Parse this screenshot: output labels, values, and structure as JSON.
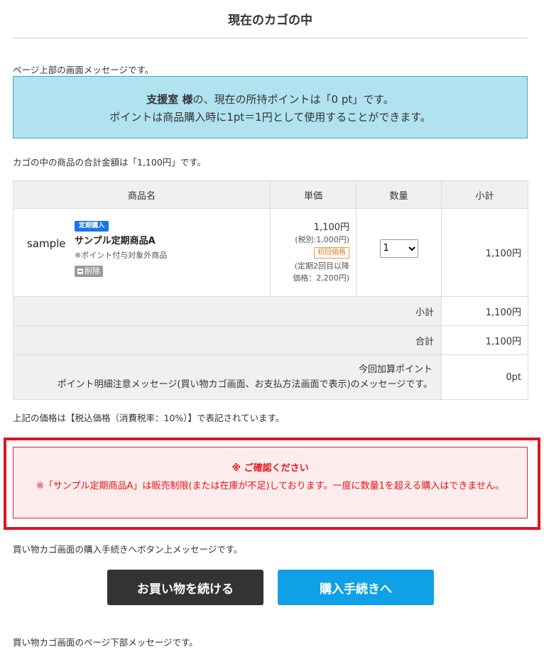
{
  "header": {
    "title": "現在のカゴの中"
  },
  "messages": {
    "top": "ページ上部の画面メッセージです。",
    "cart_total": "カゴの中の商品の合計金額は「1,100円」です。",
    "tax_note": "上記の価格は【税込価格（消費税率：10%）】で表記されています。",
    "button_top": "買い物カゴ画面の購入手続きへボタン上メッセージです。",
    "bottom": "買い物カゴ画面のページ下部メッセージです。"
  },
  "points_box": {
    "user_name": "支援室 様",
    "line1_rest": "の、現在の所持ポイントは「0 pt」です。",
    "line2": "ポイントは商品購入時に1pt＝1円として使用することができます。",
    "color": "#b1e2f0"
  },
  "table": {
    "headers": [
      "商品名",
      "単価",
      "数量",
      "小計"
    ],
    "item": {
      "image_text": "sample",
      "badge": "定期購入",
      "name": "サンプル定期商品A",
      "note": "※ポイント付与対象外商品",
      "delete_label": "削除",
      "price": "1,100円",
      "price_tax": "(税別:1,000円)",
      "first_badge": "初回価格",
      "price_next_1": "(定期2回目以降",
      "price_next_2": "価格：2,200円)",
      "quantity": "1",
      "subtotal": "1,100円"
    },
    "subtotal_label": "小計",
    "subtotal_value": "1,100円",
    "total_label": "合計",
    "total_value": "1,100円",
    "points_label_1": "今回加算ポイント",
    "points_label_2": "ポイント明細注意メッセージ(買い物カゴ画面、お支払方法画面で表示)のメッセージです。",
    "points_value": "0pt"
  },
  "alert": {
    "title": "※ ご確認ください",
    "body": "※「サンプル定期商品A」は販売制限(または在庫が不足)しております。一度に数量1を超える購入はできません。",
    "color": "#e5141d"
  },
  "buttons": {
    "continue_label": "お買い物を続ける",
    "checkout_label": "購入手続きへ",
    "continue_color": "#333333",
    "checkout_color": "#0fa0e6"
  }
}
